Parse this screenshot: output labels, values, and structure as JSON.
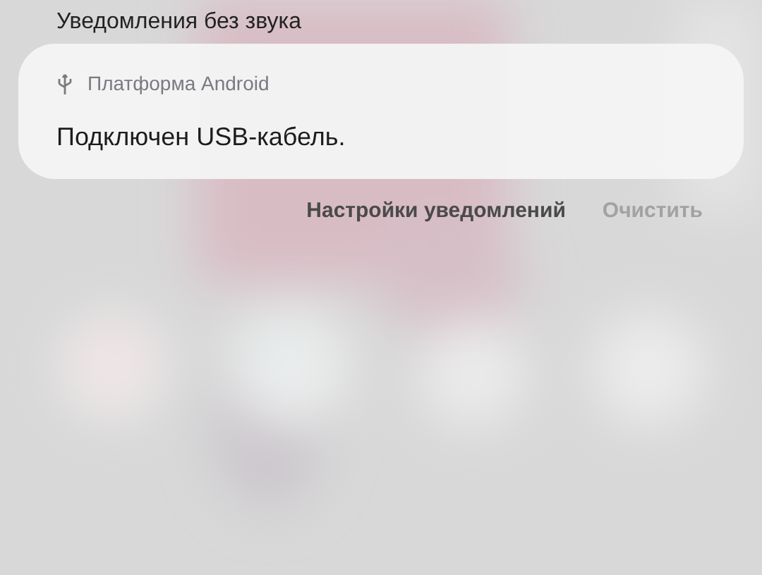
{
  "section": {
    "title": "Уведомления без звука"
  },
  "notification": {
    "app_name": "Платформа Android",
    "message": "Подключен USB-кабель."
  },
  "actions": [
    {
      "label": "Настройки уведомлений",
      "disabled": false
    },
    {
      "label": "Очистить",
      "disabled": true
    }
  ]
}
